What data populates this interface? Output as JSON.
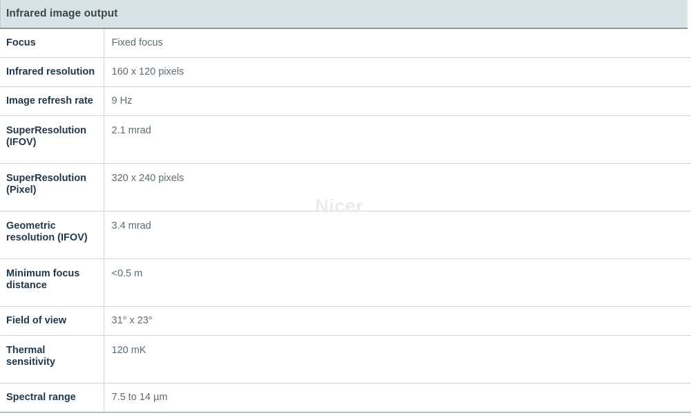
{
  "section": {
    "title": "Infrared image output",
    "header_bg": "#d9e2e4",
    "header_text_color": "#39464e",
    "label_color": "#22384a",
    "value_color": "#5c6b74",
    "border_color": "#ced6da",
    "accent_border_color": "#8b9aa3"
  },
  "watermark": {
    "text": "Nicer",
    "color": "#e9ecee"
  },
  "specs": [
    {
      "label": "Focus",
      "value": "Fixed focus",
      "multiline": false
    },
    {
      "label": "Infrared resolution",
      "value": "160 x 120 pixels",
      "multiline": false
    },
    {
      "label": "Image refresh rate",
      "value": "9 Hz",
      "multiline": false
    },
    {
      "label": "SuperResolution\n(IFOV)",
      "value": "2.1 mrad",
      "multiline": true
    },
    {
      "label": "SuperResolution\n(Pixel)",
      "value": "320 x 240 pixels",
      "multiline": true
    },
    {
      "label": "Geometric\nresolution (IFOV)",
      "value": "3.4 mrad",
      "multiline": true
    },
    {
      "label": "Minimum focus\ndistance",
      "value": "<0.5 m",
      "multiline": true
    },
    {
      "label": "Field of view",
      "value": "31° x 23°",
      "multiline": false
    },
    {
      "label": "Thermal\nsensitivity",
      "value": "120 mK",
      "multiline": true
    },
    {
      "label": "Spectral range",
      "value": "7.5 to 14 µm",
      "multiline": false
    }
  ]
}
